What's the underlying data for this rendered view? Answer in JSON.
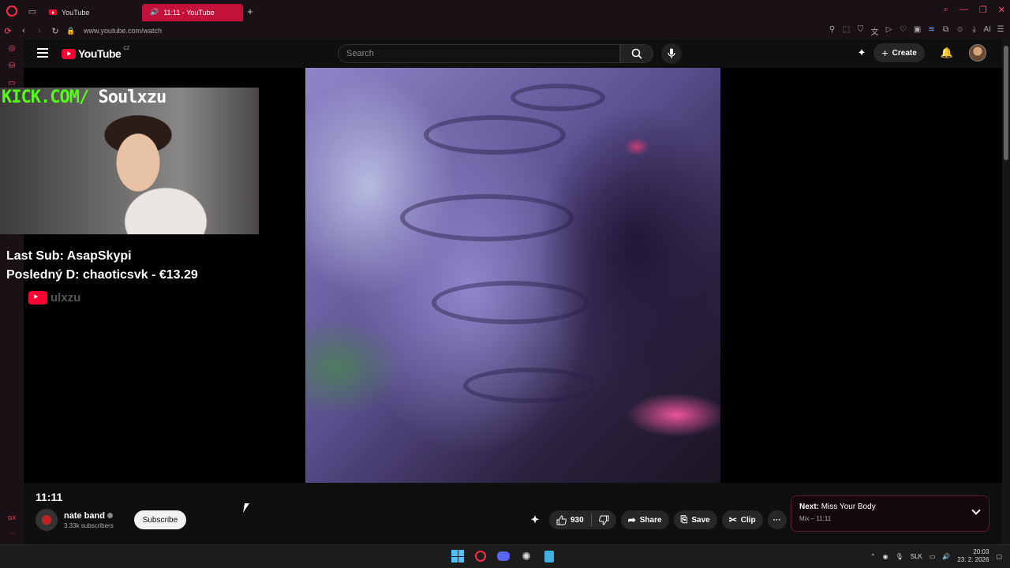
{
  "browser": {
    "tabs": [
      {
        "label": "YouTube",
        "active": false
      },
      {
        "label": "11:11 - YouTube",
        "active": true
      }
    ],
    "url": "www.youtube.com/watch",
    "ai_label": "AI",
    "sidebar_bottom": "GX"
  },
  "youtube": {
    "logo_text": "YouTube",
    "country": "CZ",
    "search_placeholder": "Search",
    "create_label": "Create"
  },
  "stream_overlay": {
    "kick_prefix": "KICK.COM/",
    "kick_name": "Soulxzu",
    "last_sub": "Last Sub: AsapSkypi",
    "last_donation": "Posledný D: chaoticsvk - €13.29",
    "yt_handle": "ulxzu"
  },
  "video": {
    "title": "11:11",
    "channel_name": "nate band",
    "subscribers": "3.33k subscribers",
    "subscribe_label": "Subscribe",
    "likes": "930",
    "share_label": "Share",
    "save_label": "Save",
    "clip_label": "Clip"
  },
  "next_card": {
    "prefix": "Next:",
    "title": "Miss Your Body",
    "subtitle": "Mix – 11:11"
  },
  "taskbar": {
    "language": "SLK",
    "time": "20:03",
    "date": "23. 2. 2026"
  },
  "colors": {
    "opera_red": "#ff2a4a",
    "active_tab": "#c4113a",
    "youtube_red": "#ff0033",
    "kick_green": "#53fc18"
  }
}
